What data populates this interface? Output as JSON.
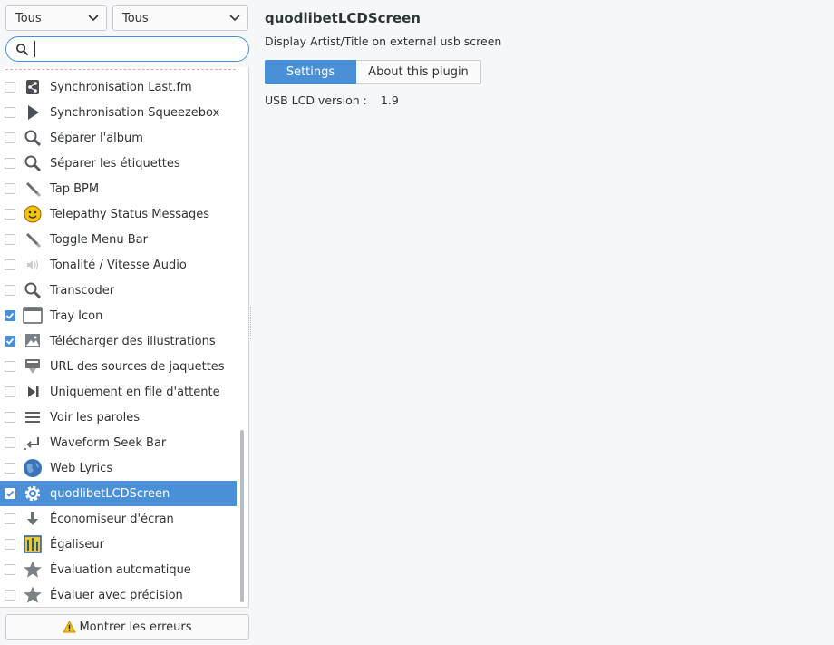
{
  "filters": {
    "combo1": "Tous",
    "combo2": "Tous"
  },
  "search": {
    "value": "",
    "icon": "search-icon"
  },
  "plugins": [
    {
      "label": "Synchronisation Last.fm",
      "checked": false,
      "icon": "share-icon"
    },
    {
      "label": "Synchronisation Squeezebox",
      "checked": false,
      "icon": "play-icon"
    },
    {
      "label": "Séparer l'album",
      "checked": false,
      "icon": "magnifier-icon"
    },
    {
      "label": "Séparer les étiquettes",
      "checked": false,
      "icon": "magnifier-icon"
    },
    {
      "label": "Tap BPM",
      "checked": false,
      "icon": "pencil-icon"
    },
    {
      "label": "Telepathy Status Messages",
      "checked": false,
      "icon": "smiley-icon"
    },
    {
      "label": "Toggle Menu Bar",
      "checked": false,
      "icon": "pencil-icon"
    },
    {
      "label": "Tonalité / Vitesse Audio",
      "checked": false,
      "icon": "speaker-icon"
    },
    {
      "label": "Transcoder",
      "checked": false,
      "icon": "magnifier-icon"
    },
    {
      "label": "Tray Icon",
      "checked": true,
      "icon": "window-icon"
    },
    {
      "label": "Télécharger des illustrations",
      "checked": true,
      "icon": "image-icon"
    },
    {
      "label": "URL des sources de jaquettes",
      "checked": false,
      "icon": "download-box-icon"
    },
    {
      "label": "Uniquement en file d'attente",
      "checked": false,
      "icon": "skip-icon"
    },
    {
      "label": "Voir les paroles",
      "checked": false,
      "icon": "lines-icon"
    },
    {
      "label": "Waveform Seek Bar",
      "checked": false,
      "icon": "seek-icon"
    },
    {
      "label": "Web Lyrics",
      "checked": false,
      "icon": "globe-icon"
    },
    {
      "label": "quodlibetLCDScreen",
      "checked": true,
      "selected": true,
      "icon": "gear-icon"
    },
    {
      "label": "Économiseur d'écran",
      "checked": false,
      "icon": "arrow-down-icon"
    },
    {
      "label": "Égaliseur",
      "checked": false,
      "icon": "equalizer-icon"
    },
    {
      "label": "Évaluation automatique",
      "checked": false,
      "icon": "star-icon"
    },
    {
      "label": "Évaluer avec précision",
      "checked": false,
      "icon": "star-icon"
    }
  ],
  "errors_button": "Montrer les erreurs",
  "detail": {
    "title": "quodlibetLCDScreen",
    "description": "Display Artist/Title on external usb screen",
    "tabs": [
      {
        "label": "Settings",
        "active": true
      },
      {
        "label": "About this plugin",
        "active": false
      }
    ],
    "version_label": "USB LCD version :",
    "version_value": "1.9"
  },
  "colors": {
    "accent": "#4a90d9",
    "background": "#f6f7f8",
    "text": "#2e3436"
  }
}
